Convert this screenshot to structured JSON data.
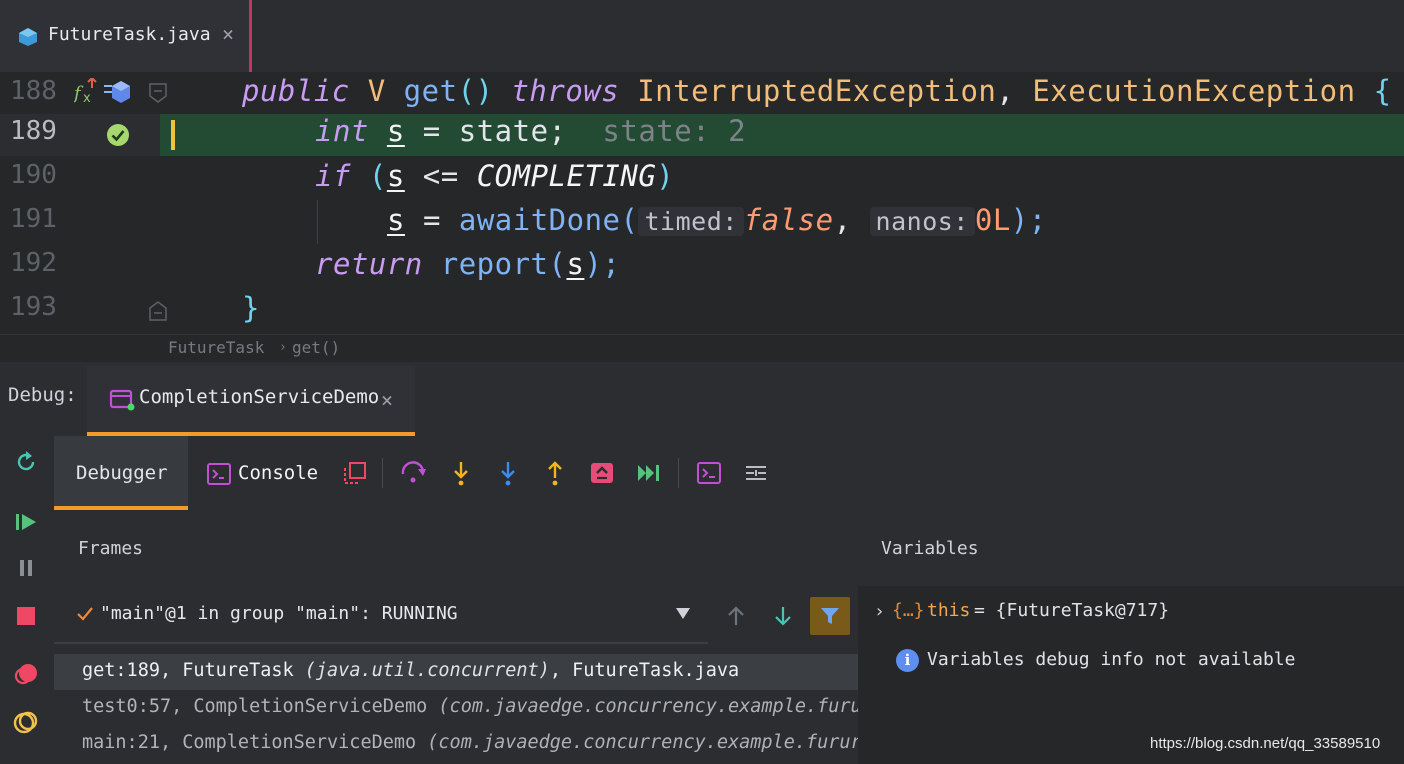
{
  "file_tab": {
    "name": "FutureTask.java",
    "close": "×"
  },
  "editor": {
    "lines": [
      {
        "num": "188"
      },
      {
        "num": "189",
        "inline_value": "state: 2"
      },
      {
        "num": "190"
      },
      {
        "num": "191",
        "hint_timed": "timed:",
        "hint_nanos": "nanos:"
      },
      {
        "num": "192"
      },
      {
        "num": "193"
      }
    ],
    "tokens": {
      "public": "public",
      "V": "V",
      "get": "get",
      "parens": "()",
      "throws": "throws",
      "ie": "InterruptedException",
      "comma": ",",
      "ee": "ExecutionException",
      "lbrace": "{",
      "int": "int",
      "s": "s",
      "eq": "=",
      "state": "state;",
      "if": "if",
      "lp": "(",
      "le": "<=",
      "completing": "COMPLETING",
      "rp": ")",
      "awaitDone": "awaitDone(",
      "false": "false",
      "comma2": ",",
      "zero": "0L",
      "close191": ");",
      "return": "return",
      "report": "report(",
      "close192": ");",
      "rbrace": "}"
    }
  },
  "breadcrumb": {
    "class_name": "FutureTask",
    "sep": "›",
    "method": "get()"
  },
  "debug": {
    "label": "Debug:",
    "session": "CompletionServiceDemo",
    "session_close": "×",
    "tabs": {
      "debugger": "Debugger",
      "console": "Console"
    },
    "frames_header": "Frames",
    "variables_header": "Variables",
    "thread": "\"main\"@1 in group \"main\": RUNNING",
    "frames": [
      {
        "loc": "get:189, FutureTask ",
        "pkg": "(java.util.concurrent)",
        "tail": ", FutureTask.java"
      },
      {
        "loc": "test0:57, CompletionServiceDemo ",
        "pkg": "(com.javaedge.concurrency.example.furur",
        "tail": ""
      },
      {
        "loc": "main:21, CompletionServiceDemo ",
        "pkg": "(com.javaedge.concurrency.example.furure",
        "tail": ""
      }
    ],
    "variables": {
      "this_brace": "{…}",
      "this_name": "this",
      "this_value": "= {FutureTask@717}",
      "info": "Variables debug info not available"
    }
  },
  "watermark": "https://blog.csdn.net/qq_33589510",
  "colors": {
    "accent": "#f39a28",
    "highlight_line": "#234a32",
    "tab_marker": "#c6335f"
  }
}
